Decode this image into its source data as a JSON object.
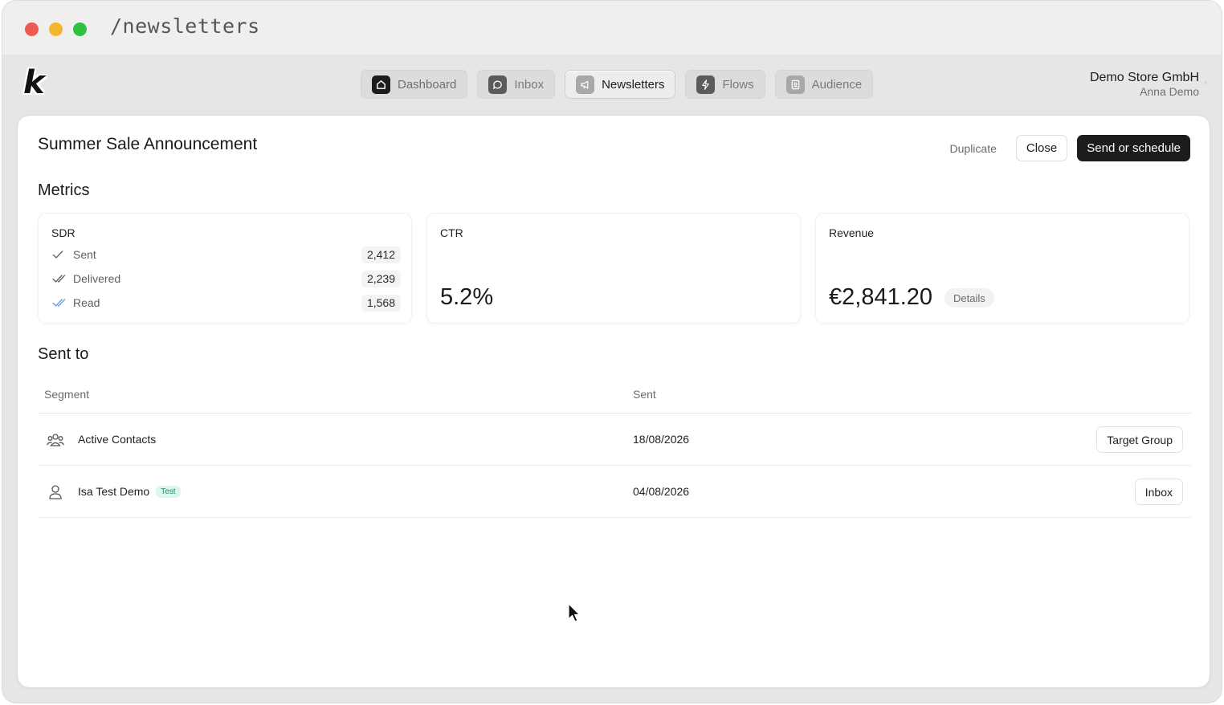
{
  "window": {
    "path": "/newsletters"
  },
  "app": {
    "logo_letter": "k",
    "nav": [
      {
        "label": "Dashboard",
        "icon": "home-icon"
      },
      {
        "label": "Inbox",
        "icon": "chat-icon"
      },
      {
        "label": "Newsletters",
        "icon": "megaphone-icon",
        "active": true
      },
      {
        "label": "Flows",
        "icon": "bolt-icon"
      },
      {
        "label": "Audience",
        "icon": "contacts-icon"
      }
    ],
    "account": {
      "company": "Demo Store GmbH",
      "user": "Anna Demo"
    }
  },
  "newsletter": {
    "title": "Summer Sale Announcement",
    "actions": {
      "duplicate": "Duplicate",
      "close": "Close",
      "send": "Send or schedule"
    }
  },
  "metrics": {
    "title": "Metrics",
    "sdr": {
      "label": "SDR",
      "rows": [
        {
          "label": "Sent",
          "value": "2,412",
          "icon": "check-icon"
        },
        {
          "label": "Delivered",
          "value": "2,239",
          "icon": "double-check-icon"
        },
        {
          "label": "Read",
          "value": "1,568",
          "icon": "double-check-blue-icon"
        }
      ]
    },
    "ctr": {
      "label": "CTR",
      "value": "5.2%"
    },
    "revenue": {
      "label": "Revenue",
      "value": "€2,841.20",
      "details": "Details"
    }
  },
  "sent_to": {
    "title": "Sent to",
    "columns": {
      "segment": "Segment",
      "sent": "Sent"
    },
    "rows": [
      {
        "name": "Active Contacts",
        "date": "18/08/2026",
        "button": "Target Group",
        "icon": "group-icon"
      },
      {
        "name": "Isa Test Demo",
        "tag": "Test",
        "date": "04/08/2026",
        "button": "Inbox",
        "icon": "person-icon"
      }
    ]
  },
  "colors": {
    "accent_dark": "#1c1c1c",
    "read_check": "#6a9ee0",
    "test_tag_bg": "#dcf6ee",
    "test_tag_text": "#1e8f6e"
  }
}
